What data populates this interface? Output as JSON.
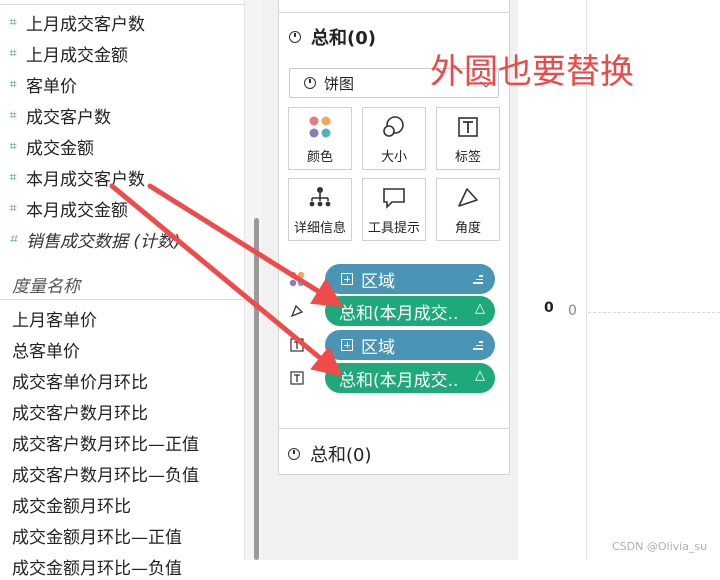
{
  "data_pane": {
    "dimension_fields": [
      {
        "label": "上月成交客户数",
        "italic": false
      },
      {
        "label": "上月成交金额",
        "italic": false
      },
      {
        "label": "客单价",
        "italic": false
      },
      {
        "label": "成交客户数",
        "italic": false
      },
      {
        "label": "成交金额",
        "italic": false
      },
      {
        "label": "本月成交客户数",
        "italic": false
      },
      {
        "label": "本月成交金额",
        "italic": false
      },
      {
        "label": "销售成交数据 (计数)",
        "italic": true
      }
    ],
    "measure_names_header": "度量名称",
    "measure_names": [
      "上月客单价",
      "总客单价",
      "成交客单价月环比",
      "成交客户数月环比",
      "成交客户数月环比—正值",
      "成交客户数月环比—负值",
      "成交金额月环比",
      "成交金额月环比—正值",
      "成交金额月环比—负值"
    ]
  },
  "marks_card": {
    "title": "总和(0)",
    "mark_type": "饼图",
    "buttons": {
      "color": "颜色",
      "size": "大小",
      "label": "标签",
      "detail": "详细信息",
      "tooltip": "工具提示",
      "angle": "角度"
    },
    "pills": [
      {
        "text": "区域",
        "kind": "dimension",
        "role": "color"
      },
      {
        "text": "总和(本月成交..",
        "kind": "measure",
        "role": "angle"
      },
      {
        "text": "区域",
        "kind": "dimension",
        "role": "label"
      },
      {
        "text": "总和(本月成交..",
        "kind": "measure",
        "role": "label"
      }
    ],
    "second_card_title": "总和(0)"
  },
  "view": {
    "axis_zero_bold": "0",
    "axis_zero_tick": "0"
  },
  "annotation": "外圆也要替换",
  "watermark": "CSDN @Olivia_su",
  "colors": {
    "dimension_pill": "#4a94b6",
    "measure_pill": "#1fa87a",
    "annotation": "#f04848",
    "field_icon": "#3aa06a"
  }
}
